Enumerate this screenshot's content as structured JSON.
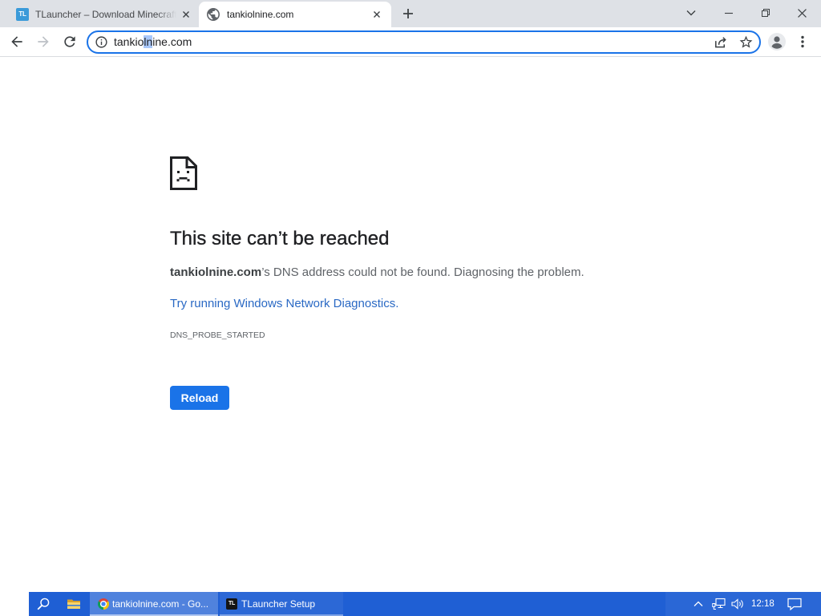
{
  "browser": {
    "tabs": [
      {
        "title": "TLauncher – Download Minecraft",
        "favicon": "tlauncher-icon",
        "favicon_text": "TL",
        "active": false,
        "close_icon": "close-icon"
      },
      {
        "title": "tankiolnine.com",
        "favicon": "globe-icon",
        "active": true,
        "close_icon": "close-icon"
      }
    ],
    "new_tab_icon": "plus-icon",
    "window_controls": [
      "chevron-down-icon",
      "minimize-icon",
      "restore-icon",
      "close-icon"
    ],
    "toolbar": {
      "back_icon": "back-arrow-icon",
      "forward_icon": "forward-arrow-icon",
      "forward_enabled": false,
      "reload_icon": "reload-icon",
      "profile_icon": "profile-icon",
      "menu_icon": "more-vert-icon"
    },
    "omnibox": {
      "focused": true,
      "site_info_icon": "info-icon",
      "url_before_selection": "tankio",
      "url_selection": "ln",
      "url_after_selection": "ine.com",
      "share_icon": "share-icon",
      "bookmark_icon": "star-icon"
    }
  },
  "error_page": {
    "icon": "sad-page-icon",
    "heading": "This site can’t be reached",
    "host": "tankiolnine.com",
    "message": "’s DNS address could not be found. Diagnosing the problem.",
    "diagnostics_link": "Try running Windows Network Diagnostics.",
    "error_code": "DNS_PROBE_STARTED",
    "reload_button": "Reload"
  },
  "taskbar": {
    "search_icon": "search-icon",
    "pinned": [
      {
        "icon": "file-explorer-icon"
      }
    ],
    "windows": [
      {
        "label": "tankiolnine.com - Go...",
        "icon": "chrome-icon",
        "active": true
      },
      {
        "label": "TLauncher Setup",
        "icon": "tlauncher-icon",
        "icon_text": "TL",
        "active": false
      }
    ],
    "tray": {
      "chevron_icon": "chevron-up-icon",
      "network_icon": "network-wired-icon",
      "volume_icon": "volume-icon",
      "clock": "12:18",
      "notification_icon": "notification-icon"
    }
  },
  "colors": {
    "accent": "#1a73e8",
    "tabstrip": "#dee1e6",
    "link": "#2a69c4",
    "heading": "#202124",
    "body_text": "#5f6368",
    "taskbar": "#1f5fd4"
  }
}
